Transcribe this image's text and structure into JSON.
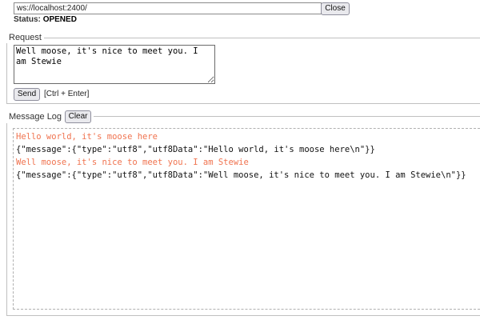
{
  "connection": {
    "url": "ws://localhost:2400/",
    "close_label": "Close",
    "status_label": "Status:",
    "status_value": "OPENED"
  },
  "request": {
    "legend": "Request",
    "text": "Well moose, it's nice to meet you. I am Stewie",
    "send_label": "Send",
    "hint": "[Ctrl + Enter]"
  },
  "log": {
    "legend": "Message Log",
    "clear_label": "Clear",
    "entries": [
      {
        "kind": "sent",
        "text": "Hello world, it's moose here"
      },
      {
        "kind": "recv",
        "text": "{\"message\":{\"type\":\"utf8\",\"utf8Data\":\"Hello world, it's moose here\\n\"}}"
      },
      {
        "kind": "sent",
        "text": "Well moose, it's nice to meet you. I am Stewie"
      },
      {
        "kind": "recv",
        "text": "{\"message\":{\"type\":\"utf8\",\"utf8Data\":\"Well moose, it's nice to meet you. I am Stewie\\n\"}}"
      }
    ]
  },
  "colors": {
    "sent_message": "#f0734f",
    "received_message": "#111111"
  }
}
